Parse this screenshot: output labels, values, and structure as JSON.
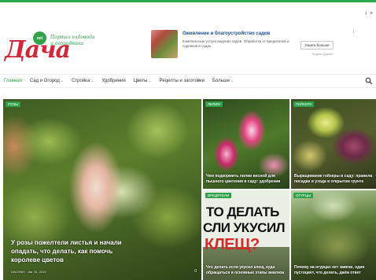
{
  "colors": {
    "accent": "#2e9e48",
    "logo": "#d0283b",
    "ad_title": "#1d4f9a"
  },
  "ad_controls": {
    "info_icon": "i-icon",
    "close_icon": "close-icon",
    "info": "i",
    "close": "×"
  },
  "logo": {
    "word": "Дача",
    "badge": "net",
    "tagline": "Портал садовода и огородника"
  },
  "ad": {
    "title": "Оживление и благоустройство садов",
    "text": "Комплексные услуги ведения садов. Обработка от вредителей и сорняков в садах.",
    "button": "Узнать больше",
    "sub": "Яндекс Директ",
    "info": "i"
  },
  "nav": {
    "items": [
      {
        "label": "Главная",
        "has_menu": false,
        "chev": ""
      },
      {
        "label": "Сад и Огород",
        "has_menu": true,
        "chev": "⌄"
      },
      {
        "label": "Стройка",
        "has_menu": true,
        "chev": "⌄"
      },
      {
        "label": "Удобрения",
        "has_menu": false,
        "chev": ""
      },
      {
        "label": "Цветы",
        "has_menu": true,
        "chev": "⌄"
      },
      {
        "label": "Рецепты и заготовки",
        "has_menu": false,
        "chev": ""
      },
      {
        "label": "Больше",
        "has_menu": true,
        "chev": "⌄"
      }
    ],
    "search_icon": "search-icon"
  },
  "tiles": {
    "big": {
      "tag": "Розы",
      "title": "У розы пожелтели листья и начали опадать, что делать, как помочь королеве цветов",
      "author": "DACHNIK",
      "date": "Авг 24, 2019",
      "comments": "0"
    },
    "t1": {
      "tag": "Лилии",
      "title": "Чем подкормить лилии весной для пышного цветения в саду: удобрения"
    },
    "t2": {
      "tag": "Гейхера",
      "title": "Выращивание гейхеры в саду: правила посадки и ухода в открытом грунте"
    },
    "t3": {
      "tag": "Вредители",
      "line1": "ТО ДЕЛАТЬ",
      "line2": "СЛИ УКУСИЛ",
      "line3": "КЛЕЩ?",
      "title": "Что делать если укусил клещ, куда обращаться и основные этапы анализа"
    },
    "t4": {
      "tag": "Огурцы",
      "title": "Почему на огурцах нет завязи, один пустоцвет, что делать, даём ответ"
    }
  }
}
